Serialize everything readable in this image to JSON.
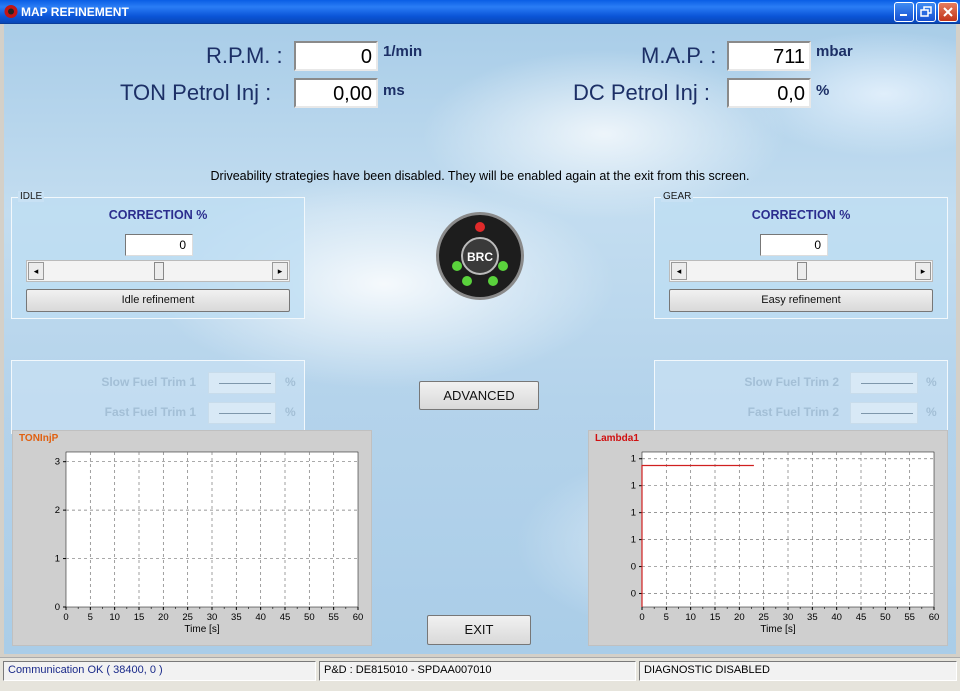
{
  "window": {
    "title": "MAP REFINEMENT"
  },
  "readouts": {
    "rpm": {
      "label": "R.P.M. :",
      "value": "0",
      "unit": "1/min"
    },
    "ton": {
      "label": "TON Petrol Inj :",
      "value": "0,00",
      "unit": "ms"
    },
    "map": {
      "label": "M.A.P. :",
      "value": "711",
      "unit": "mbar"
    },
    "dc": {
      "label": "DC Petrol Inj :",
      "value": "0,0",
      "unit": "%"
    }
  },
  "notice": "Driveability strategies have been disabled. They will be enabled again at the exit from this screen.",
  "idle": {
    "group_label": "IDLE",
    "correction_title": "CORRECTION %",
    "value": "0",
    "slider_level": 0.5,
    "button": "Idle refinement"
  },
  "gear": {
    "group_label": "GEAR",
    "correction_title": "CORRECTION %",
    "value": "0",
    "slider_level": 0.5,
    "button": "Easy refinement"
  },
  "logo": {
    "text": "BRC"
  },
  "advanced_button": "ADVANCED",
  "exit_button": "EXIT",
  "trims_left": {
    "slow": "Slow Fuel Trim 1",
    "fast": "Fast Fuel Trim 1",
    "pct": "%"
  },
  "trims_right": {
    "slow": "Slow Fuel Trim 2",
    "fast": "Fast Fuel Trim 2",
    "pct": "%"
  },
  "chart_data": [
    {
      "type": "line",
      "title": "TONInjP",
      "title_color": "#e06010",
      "xlabel": "Time [s]",
      "ylabel": "",
      "xlim": [
        0,
        60
      ],
      "ylim": [
        0,
        3.2
      ],
      "x_ticks": [
        "0",
        "5",
        "10",
        "15",
        "20",
        "25",
        "30",
        "35",
        "40",
        "45",
        "50",
        "55",
        "60"
      ],
      "y_ticks": [
        {
          "value": 0,
          "label": "0"
        },
        {
          "value": 1,
          "label": "1"
        },
        {
          "value": 2,
          "label": "2"
        },
        {
          "value": 3,
          "label": "3"
        }
      ],
      "grid": true,
      "series": []
    },
    {
      "type": "line",
      "title": "Lambda1",
      "title_color": "#d01010",
      "xlabel": "Time [s]",
      "ylabel": "",
      "xlim": [
        0,
        60
      ],
      "ylim": [
        -0.1,
        1.05
      ],
      "x_ticks": [
        "0",
        "5",
        "10",
        "15",
        "20",
        "25",
        "30",
        "35",
        "40",
        "45",
        "50",
        "55",
        "60"
      ],
      "y_ticks": [
        {
          "value": 0,
          "label": "0"
        },
        {
          "value": 0.2,
          "label": "0"
        },
        {
          "value": 0.4,
          "label": "1"
        },
        {
          "value": 0.6,
          "label": "1"
        },
        {
          "value": 0.8,
          "label": "1"
        },
        {
          "value": 1.0,
          "label": "1"
        }
      ],
      "grid": true,
      "series": [
        {
          "color": "#d02020",
          "x": [
            0,
            0,
            23
          ],
          "y": [
            -0.1,
            0.95,
            0.95
          ]
        }
      ]
    }
  ],
  "status": {
    "comm": "Communication OK ( 38400,  0 )",
    "pd": "P&D : DE815010 - SPDAA007010",
    "diag": "DIAGNOSTIC DISABLED"
  }
}
